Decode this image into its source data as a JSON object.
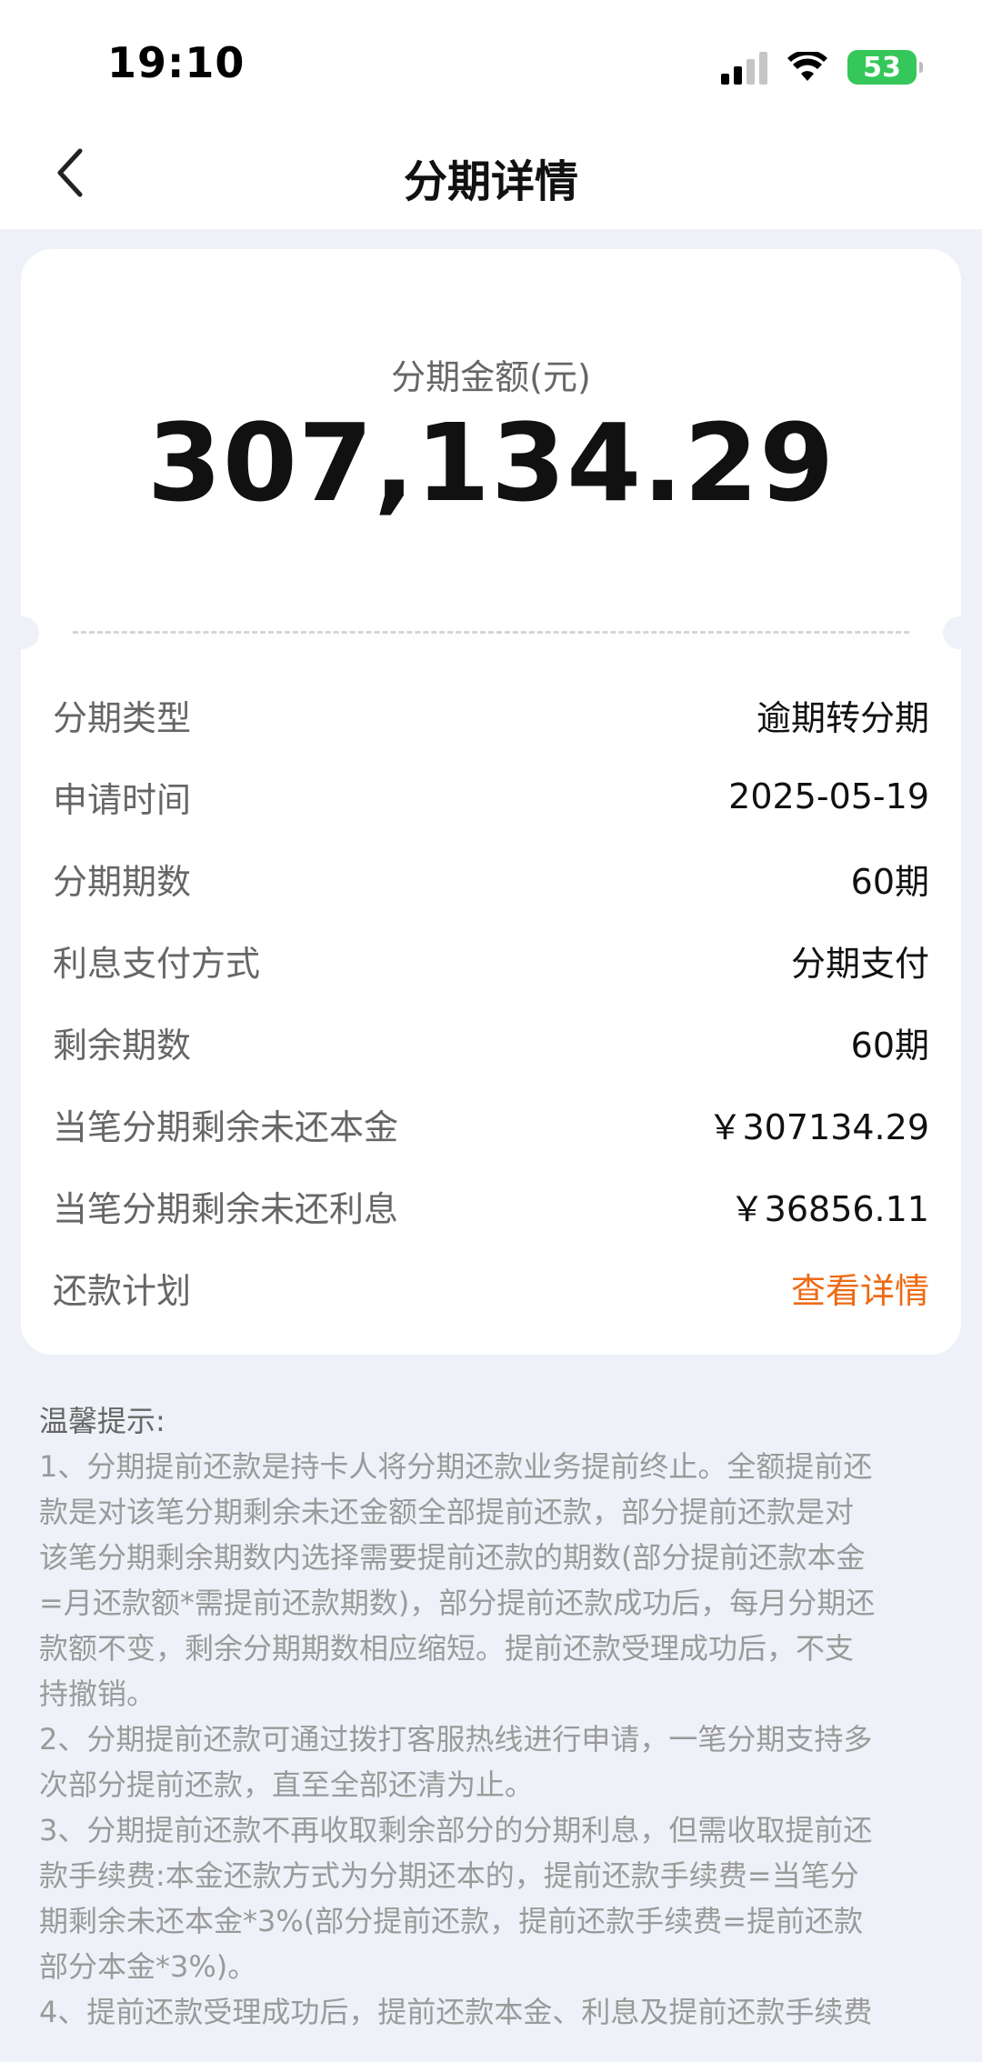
{
  "status_bar": {
    "time": "19:10",
    "battery": "53"
  },
  "header": {
    "title": "分期详情"
  },
  "summary": {
    "amount_label": "分期金额(元)",
    "amount_value": "307,134.29"
  },
  "details": [
    {
      "label": "分期类型",
      "value": "逾期转分期"
    },
    {
      "label": "申请时间",
      "value": "2025-05-19"
    },
    {
      "label": "分期期数",
      "value": "60期"
    },
    {
      "label": "利息支付方式",
      "value": "分期支付"
    },
    {
      "label": "剩余期数",
      "value": "60期"
    },
    {
      "label": "当笔分期剩余未还本金",
      "value": "￥307134.29"
    },
    {
      "label": "当笔分期剩余未还利息",
      "value": "￥36856.11"
    },
    {
      "label": "还款计划",
      "value": "查看详情"
    }
  ],
  "colors": {
    "link": "#ee6a14",
    "battery": "#35c759",
    "page_bg": "#eef1f7"
  },
  "notice": {
    "title": "温馨提示:",
    "lines": [
      "1、分期提前还款是持卡人将分期还款业务提前终止。全额提前还",
      "款是对该笔分期剩余未还金额全部提前还款，部分提前还款是对",
      "该笔分期剩余期数内选择需要提前还款的期数(部分提前还款本金",
      "=月还款额*需提前还款期数)，部分提前还款成功后，每月分期还",
      "款额不变，剩余分期期数相应缩短。提前还款受理成功后，不支",
      "持撤销。",
      "2、分期提前还款可通过拨打客服热线进行申请，一笔分期支持多",
      "次部分提前还款，直至全部还清为止。",
      "3、分期提前还款不再收取剩余部分的分期利息，但需收取提前还",
      "款手续费:本金还款方式为分期还本的，提前还款手续费=当笔分",
      "期剩余未还本金*3%(部分提前还款，提前还款手续费=提前还款",
      "部分本金*3%)。",
      "4、提前还款受理成功后，提前还款本金、利息及提前还款手续费"
    ]
  }
}
